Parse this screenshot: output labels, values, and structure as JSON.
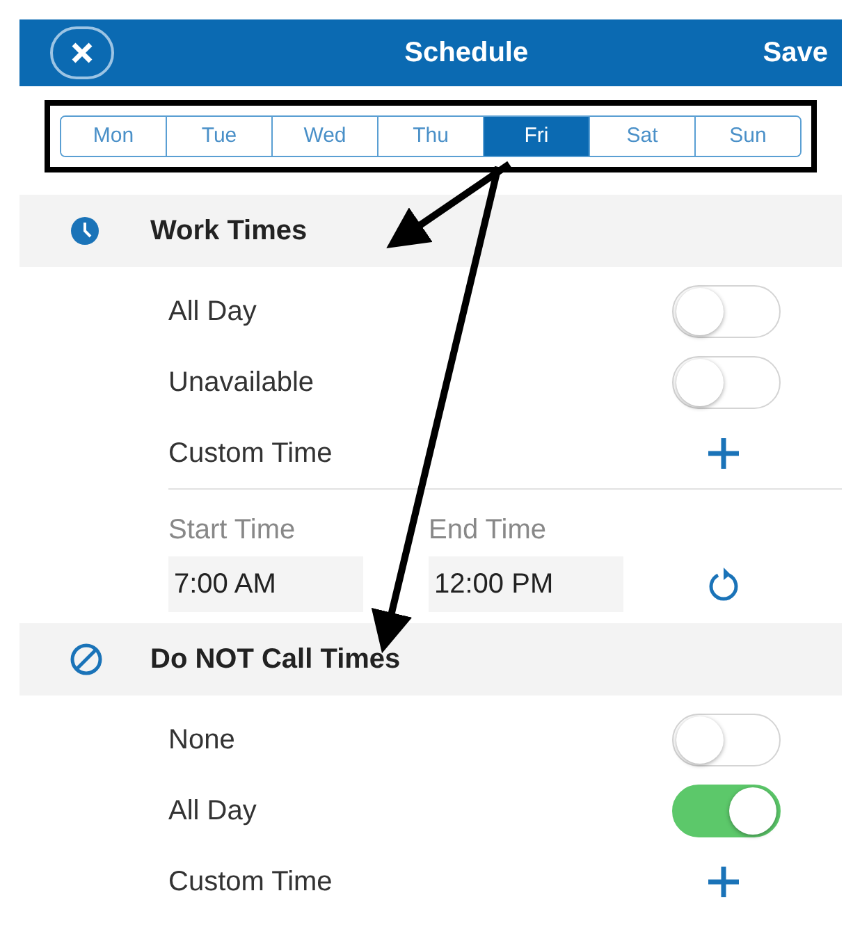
{
  "header": {
    "title": "Schedule",
    "action": "Save"
  },
  "days": [
    {
      "label": "Mon",
      "selected": false
    },
    {
      "label": "Tue",
      "selected": false
    },
    {
      "label": "Wed",
      "selected": false
    },
    {
      "label": "Thu",
      "selected": false
    },
    {
      "label": "Fri",
      "selected": true
    },
    {
      "label": "Sat",
      "selected": false
    },
    {
      "label": "Sun",
      "selected": false
    }
  ],
  "sections": [
    {
      "title": "Work Times",
      "kind": "clock",
      "rows": [
        {
          "kind": "toggle",
          "label": "All Day",
          "on": false
        },
        {
          "kind": "toggle",
          "label": "Unavailable",
          "on": false
        },
        {
          "kind": "add",
          "label": "Custom Time"
        },
        {
          "kind": "times",
          "start_label": "Start Time",
          "start_value": "7:00 AM",
          "end_label": "End Time",
          "end_value": "12:00 PM"
        }
      ]
    },
    {
      "title": "Do NOT Call Times",
      "kind": "block",
      "rows": [
        {
          "kind": "toggle",
          "label": "None",
          "on": false
        },
        {
          "kind": "toggle",
          "label": "All Day",
          "on": true
        },
        {
          "kind": "add",
          "label": "Custom Time"
        }
      ]
    }
  ]
}
